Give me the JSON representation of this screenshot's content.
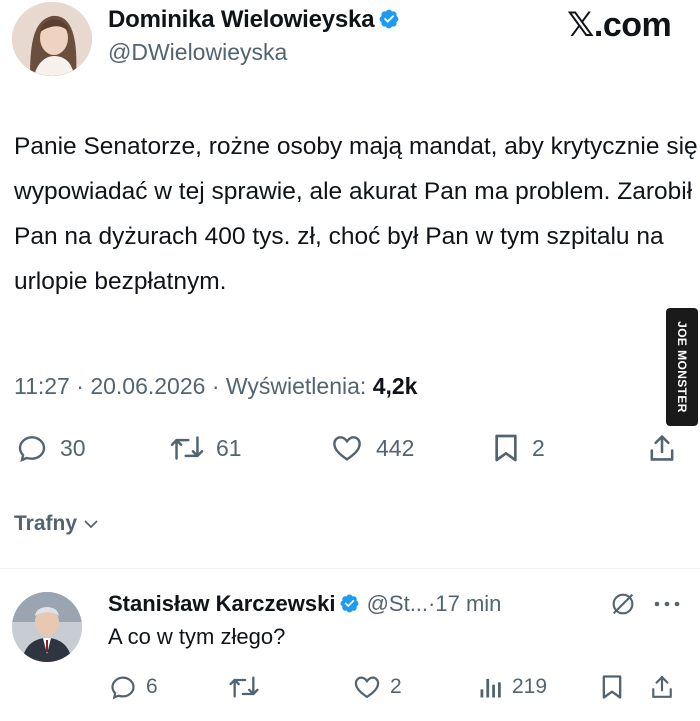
{
  "post": {
    "author_name": "Dominika Wielowieyska",
    "author_handle": "@DWielowieyska",
    "text": "Panie Senatorze, rożne osoby mają mandat, aby krytycznie się wypowiadać w tej sprawie, ale akurat Pan ma problem. Zarobił Pan na dyżurach 400 tys. zł, choć był Pan w tym szpitalu na urlopie bezpłatnym.",
    "time": "11:27",
    "date": "20.06.2026",
    "views_label": "Wyświetlenia:",
    "views_value": "4,2k",
    "replies": "30",
    "reposts": "61",
    "likes": "442",
    "bookmarks": "2"
  },
  "site_logo": {
    "mark": "𝕏",
    "suffix": ".com"
  },
  "watermark": "JOE MONSTER",
  "sort": {
    "label": "Trafny"
  },
  "reply": {
    "author_name": "Stanisław Karczewski",
    "author_handle": "@St...",
    "time": "17 min",
    "text": "A co w tym złego?",
    "replies": "6",
    "reposts": "",
    "likes": "2",
    "views": "219"
  },
  "colors": {
    "text": "#0f1419",
    "secondary": "#536471",
    "verified": "#1d9bf0",
    "divider": "#eff3f4"
  },
  "icons": [
    "verified-badge-icon",
    "reply-icon",
    "repost-icon",
    "like-icon",
    "bookmark-icon",
    "share-icon",
    "chevron-down-icon",
    "grok-icon",
    "more-icon",
    "views-icon"
  ]
}
